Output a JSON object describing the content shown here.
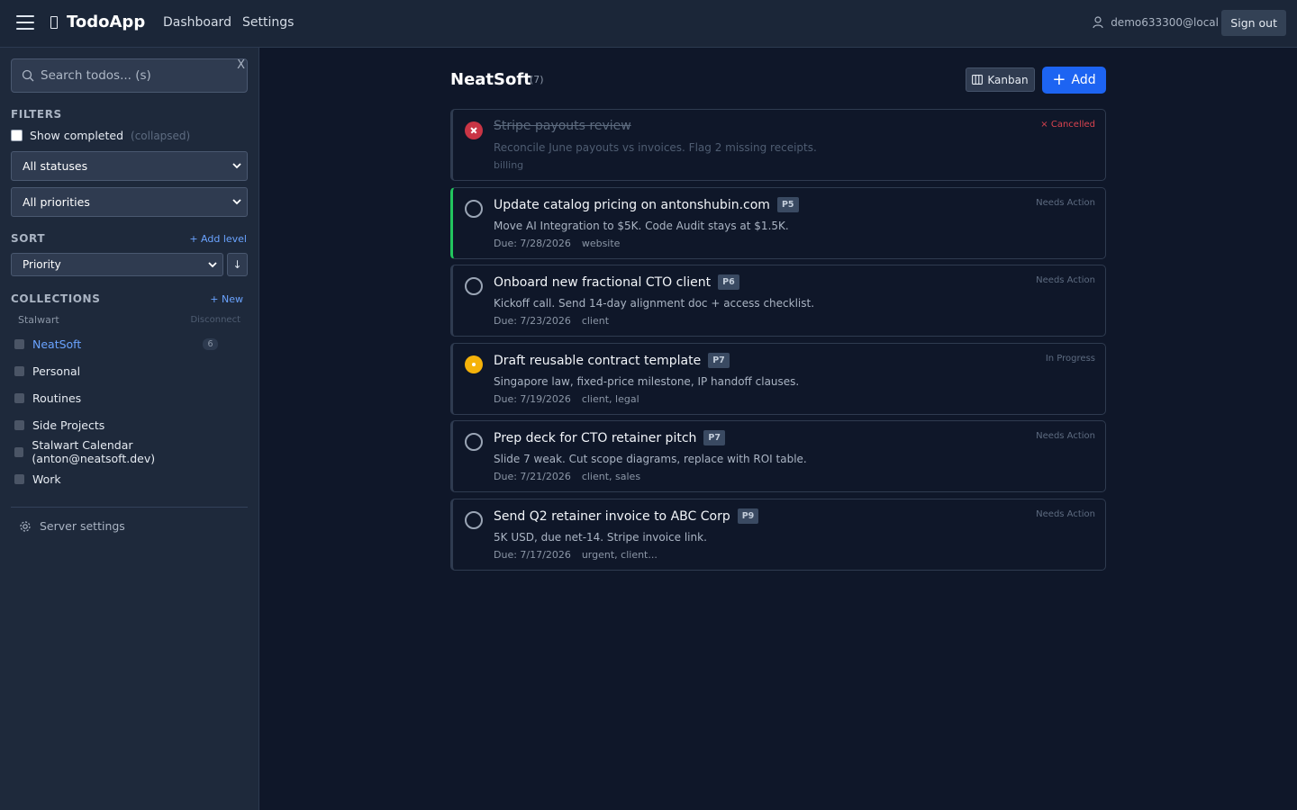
{
  "header": {
    "brand": "TodoApp",
    "nav": [
      "Dashboard",
      "Settings"
    ],
    "user_email": "demo633300@local",
    "signout_label": "Sign out"
  },
  "sidebar": {
    "search_placeholder": "Search todos... (s)",
    "search_clear": "X",
    "filters_title": "FILTERS",
    "show_completed_label": "Show completed",
    "show_completed_note": "(collapsed)",
    "show_completed_checked": false,
    "status_select": "All statuses",
    "priority_select": "All priorities",
    "sort_title": "SORT",
    "add_level": "+ Add level",
    "sort_select": "Priority",
    "sort_direction": "↓",
    "collections_title": "COLLECTIONS",
    "new_collection": "+ New",
    "account": "Stalwart",
    "disconnect": "Disconnect",
    "collections": [
      {
        "label": "NeatSoft",
        "count": "6",
        "active": true
      },
      {
        "label": "Personal",
        "count": "",
        "active": false
      },
      {
        "label": "Routines",
        "count": "",
        "active": false
      },
      {
        "label": "Side Projects",
        "count": "",
        "active": false
      },
      {
        "label": "Stalwart Calendar (anton@neatsoft.dev)",
        "count": "",
        "active": false
      },
      {
        "label": "Work",
        "count": "",
        "active": false
      }
    ],
    "server_settings": "Server settings"
  },
  "main": {
    "title": "NeatSoft",
    "count": "(7)",
    "kanban_label": "Kanban",
    "add_label": "Add",
    "todos": [
      {
        "title": "Stripe payouts review",
        "priority": "",
        "description": "Reconcile June payouts vs invoices. Flag 2 missing receipts.",
        "due": "",
        "tags": "billing",
        "status": "× Cancelled",
        "state": "cancelled"
      },
      {
        "title": "Update catalog pricing on antonshubin.com",
        "priority": "P5",
        "description": "Move AI Integration to $5K. Code Audit stays at $1.5K.",
        "due": "Due: 7/28/2026",
        "tags": "website",
        "status": "Needs Action",
        "state": "needs-action"
      },
      {
        "title": "Onboard new fractional CTO client",
        "priority": "P6",
        "description": "Kickoff call. Send 14-day alignment doc + access checklist.",
        "due": "Due: 7/23/2026",
        "tags": "client",
        "status": "Needs Action",
        "state": "needs-action"
      },
      {
        "title": "Draft reusable contract template",
        "priority": "P7",
        "description": "Singapore law, fixed-price milestone, IP handoff clauses.",
        "due": "Due: 7/19/2026",
        "tags": "client, legal",
        "status": "In Progress",
        "state": "in-progress"
      },
      {
        "title": "Prep deck for CTO retainer pitch",
        "priority": "P7",
        "description": "Slide 7 weak. Cut scope diagrams, replace with ROI table.",
        "due": "Due: 7/21/2026",
        "tags": "client, sales",
        "status": "Needs Action",
        "state": "needs-action"
      },
      {
        "title": "Send Q2 retainer invoice to ABC Corp",
        "priority": "P9",
        "description": "5K USD, due net-14. Stripe invoice link.",
        "due": "Due: 7/17/2026",
        "tags": "urgent, client...",
        "status": "Needs Action",
        "state": "needs-action"
      }
    ]
  },
  "colors": {
    "accent": "#1d64f2",
    "in_progress": "#f5b20a",
    "cancelled": "#c93545",
    "highlight_border": "#22c55e"
  }
}
